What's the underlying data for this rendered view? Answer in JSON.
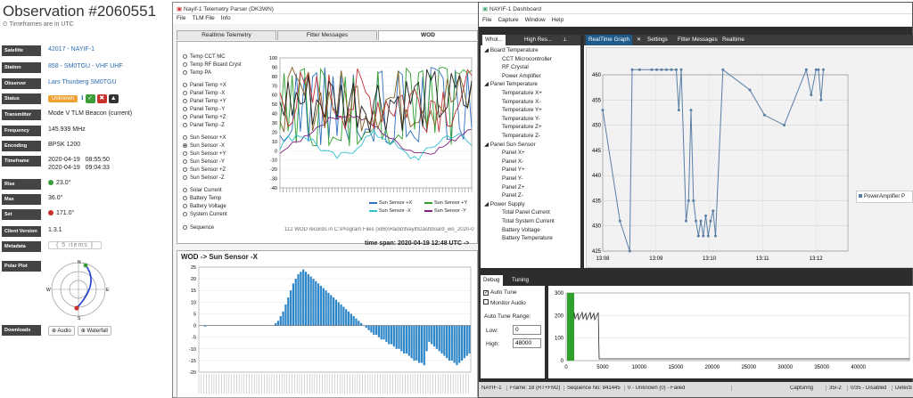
{
  "observation": {
    "title": "Observation #2060551",
    "timezone_note": "Timeframes are in UTC",
    "rows": [
      {
        "label": "Satellite",
        "value": "42017 - NAYIF-1",
        "type": "link"
      },
      {
        "label": "Station",
        "value": "858 - SM0TGU - VHF UHF",
        "type": "link"
      },
      {
        "label": "Observer",
        "value": "Lars Thunberg SM0TGU",
        "type": "link"
      },
      {
        "label": "Status",
        "value": "Unknown",
        "type": "status"
      },
      {
        "label": "Transmitter",
        "value": "Mode V TLM Beacon (current)",
        "type": "text"
      },
      {
        "label": "Frequency",
        "value": "145.939 MHz",
        "type": "text"
      },
      {
        "label": "Encoding",
        "value": "BPSK 1200",
        "type": "text"
      },
      {
        "label": "Timeframe",
        "value": "2020-04-19   08:55:50",
        "value2": "2020-04-19   09:04:33",
        "type": "text2"
      },
      {
        "label": "Rise",
        "value": "23.0°",
        "type": "rise"
      },
      {
        "label": "Max",
        "value": "36.0°",
        "type": "text"
      },
      {
        "label": "Set",
        "value": "171.0°",
        "type": "set"
      },
      {
        "label": "Client Version",
        "value": "1.3.1",
        "type": "text"
      },
      {
        "label": "Metadata",
        "value": "{ 5 items }",
        "type": "meta"
      },
      {
        "label": "Polar Plot",
        "value": "",
        "type": "polar"
      },
      {
        "label": "Downloads",
        "value": "",
        "type": "downloads"
      }
    ],
    "downloads": {
      "audio": "Audio",
      "waterfall": "Waterfall"
    },
    "polar": {
      "n": "N",
      "e": "E",
      "s": "S",
      "w": "W"
    }
  },
  "parser": {
    "title": "Nayif-1 Telemetry Parser (DK3WN)",
    "menu": [
      "File",
      "TLM File",
      "Info"
    ],
    "tabs": [
      "Realtime Telemetry",
      "Fitter Messages",
      "WOD"
    ],
    "radios": [
      "Temp CCT MC",
      "Temp RF Board Cryst",
      "Temp PA",
      "Panel Temp +X",
      "Panel Temp -X",
      "Panel Temp +Y",
      "Panel Temp -Y",
      "Panel Temp +Z",
      "Panel Temp -Z",
      "Sun Sensor +X",
      "Sun Sensor -X",
      "Sun Sensor +Y",
      "Sun Sensor -Y",
      "Sun Sensor +Z",
      "Sun Sensor -Z",
      "Solar Current",
      "Battery Temp",
      "Battery Voltage",
      "System Current",
      "Sequence"
    ],
    "selected_radio": "Sun Sensor -X",
    "top_chart": {
      "yticks": [
        "100",
        "90",
        "80",
        "70",
        "60",
        "50",
        "40",
        "30",
        "20",
        "10",
        "0",
        "-10",
        "-20",
        "-30",
        "-40"
      ],
      "legend": [
        "Sun Sensor +X",
        "Sun Sensor +Y",
        "Sun Sensor -X",
        "Sun Sensor -Y"
      ],
      "legend_colors": [
        "#3070c0",
        "#30a030",
        "#30c0d0",
        "#802080"
      ]
    },
    "records_text": "112 WOD records in C:\\Program Files (x86)\\Radio\\Nayif\\Dashboard_wo_2020-0",
    "timespan": "time span: 2020-04-19 12:48 UTC ->",
    "bottom_title": "WOD -> Sun Sensor -X",
    "bottom_yticks": [
      "25",
      "20",
      "15",
      "10",
      "5",
      "0",
      "-5",
      "-10",
      "-15",
      "-20"
    ]
  },
  "chart_data": {
    "type": "bar",
    "title": "WOD -> Sun Sensor -X",
    "ylim": [
      -20,
      25
    ],
    "values": [
      0,
      0,
      -0.5,
      0,
      0,
      0,
      0,
      0,
      0,
      0,
      0,
      0,
      0,
      0,
      0,
      0,
      0,
      0,
      0,
      0,
      0,
      0,
      0,
      0,
      0,
      0,
      0,
      0,
      0,
      0,
      1,
      2,
      4,
      6,
      9,
      12,
      15,
      18,
      20,
      22,
      23,
      24,
      23,
      22,
      21,
      20,
      19,
      18,
      17,
      16,
      15,
      14,
      13,
      12,
      11,
      10,
      9,
      8,
      7,
      6,
      5,
      4,
      3,
      2,
      1,
      0,
      -1,
      -2,
      -3,
      -4,
      -4,
      -5,
      -6,
      -6,
      -7,
      -8,
      -8,
      -9,
      -10,
      -10,
      -11,
      -12,
      -12,
      -13,
      -14,
      -15,
      -15,
      -16,
      -16,
      -17,
      -11,
      -7,
      -8,
      -9,
      -10,
      -11,
      -12,
      -13,
      -14,
      -15,
      -15,
      -16,
      -17,
      -16,
      -15,
      -14,
      -13,
      -12
    ]
  },
  "dashboard": {
    "title": "NAYIF-1 Dashboard",
    "menu": [
      "File",
      "Capture",
      "Window",
      "Help"
    ],
    "left_tabs": [
      "Whol...",
      "High Res..."
    ],
    "right_tabs": [
      "RealTime Graph",
      "Settings",
      "Fitter Messages",
      "Realtime"
    ],
    "tree": [
      {
        "text": "Board Temperature",
        "level": 0
      },
      {
        "text": "CCT Microcontroller",
        "level": 1
      },
      {
        "text": "RF Crystal",
        "level": 1
      },
      {
        "text": "Power Amplifier",
        "level": 1
      },
      {
        "text": "Panel Temperature",
        "level": 0
      },
      {
        "text": "Temperature X+",
        "level": 1
      },
      {
        "text": "Temperature X-",
        "level": 1
      },
      {
        "text": "Temperature Y+",
        "level": 1
      },
      {
        "text": "Temperature Y-",
        "level": 1
      },
      {
        "text": "Temperature Z+",
        "level": 1
      },
      {
        "text": "Temperature Z-",
        "level": 1
      },
      {
        "text": "Panel Sun Sensor",
        "level": 0
      },
      {
        "text": "Panel X+",
        "level": 1
      },
      {
        "text": "Panel X-",
        "level": 1
      },
      {
        "text": "Panel Y+",
        "level": 1
      },
      {
        "text": "Panel Y-",
        "level": 1
      },
      {
        "text": "Panel Z+",
        "level": 1
      },
      {
        "text": "Panel Z-",
        "level": 1
      },
      {
        "text": "Power Supply",
        "level": 0
      },
      {
        "text": "Total Panel Current",
        "level": 1
      },
      {
        "text": "Total System Current",
        "level": 1
      },
      {
        "text": "Battery Voltage",
        "level": 1
      },
      {
        "text": "Battery Temperature",
        "level": 1
      }
    ],
    "graph": {
      "yticks": [
        "460",
        "455",
        "450",
        "445",
        "440",
        "435",
        "430",
        "425"
      ],
      "xticks": [
        "13:08",
        "13:09",
        "13:10",
        "13:11",
        "13:12"
      ],
      "legend": "PowerAmplifier P"
    },
    "debug_tabs": [
      "Debug",
      "Tuning"
    ],
    "tuning": {
      "auto_tune": "Auto Tune",
      "monitor_audio": "Monitor Audio",
      "range_label": "Auto Tune Range:",
      "low_label": "Low:",
      "low_value": "0",
      "high_label": "High:",
      "high_value": "48000"
    },
    "spectrum": {
      "yticks": [
        "300",
        "200",
        "100",
        "0"
      ],
      "xticks": [
        "0",
        "5000",
        "10000",
        "15000",
        "20000",
        "25000",
        "30000",
        "35000",
        "40000"
      ]
    },
    "status": [
      "NAYIF-1",
      "Frame: 18 (RT+FM2)",
      "Sequence No: 841445",
      "0 - Unknown (0) - Failed",
      "",
      "Capturing",
      "35/-2",
      "0/35 - Disabled",
      "Detecti"
    ]
  }
}
